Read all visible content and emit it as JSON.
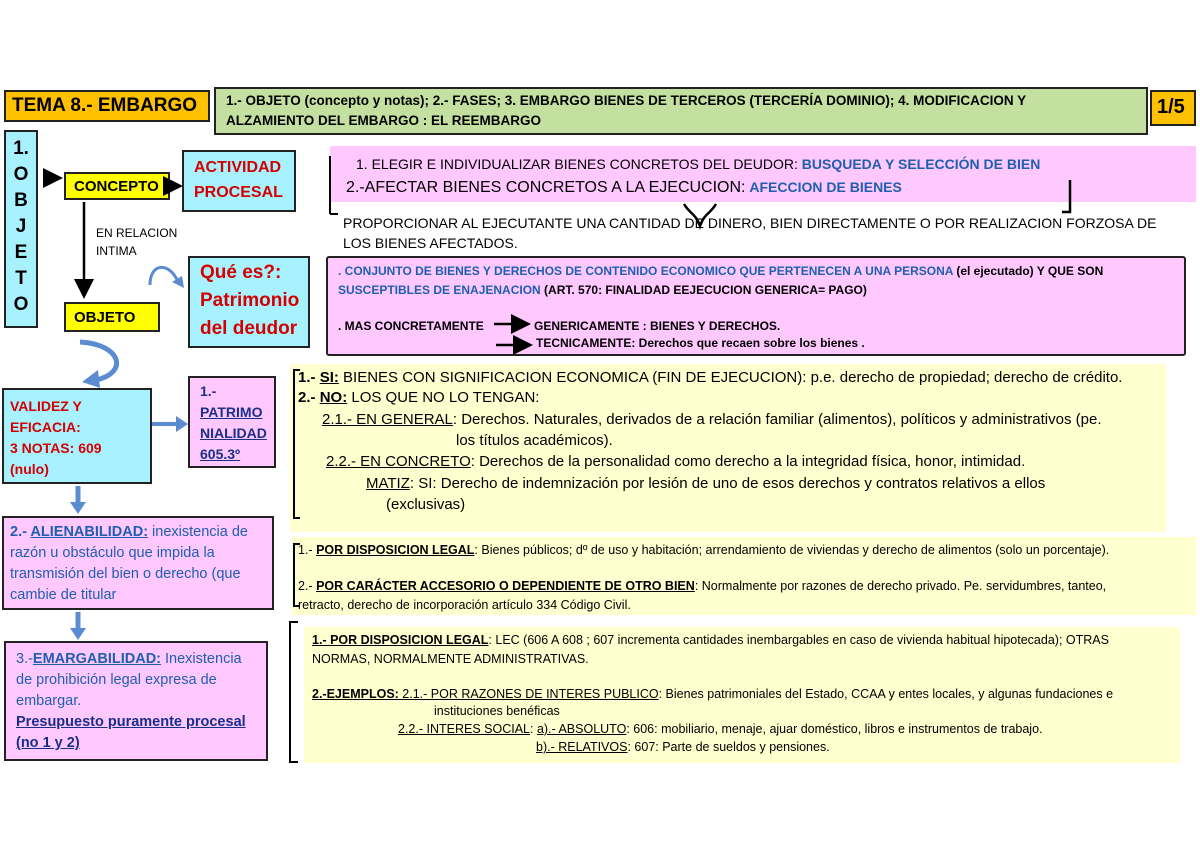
{
  "header": {
    "tema": "TEMA 8.- EMBARGO",
    "objetivos_1": "1.- OBJETO (concepto y notas); 2.- FASES; 3. EMBARGO BIENES DE TERCEROS (TERCERÍA DOMINIO); 4. MODIFICACION Y",
    "objetivos_2": "ALZAMIENTO DEL EMBARGO : EL REEMBARGO",
    "page": "1/5"
  },
  "objeto_col": [
    "1.",
    "O",
    "B",
    "J",
    "E",
    "T",
    "O"
  ],
  "concepto": "CONCEPTO",
  "actividad_1": "ACTIVIDAD",
  "actividad_2": "PROCESAL",
  "relacion_1": "EN RELACION",
  "relacion_2": "INTIMA",
  "que_es_1": "Qué es?:",
  "que_es_2": "Patrimonio",
  "que_es_3": "del deudor",
  "objeto": "OBJETO",
  "fases": {
    "f1_a": "1. ELEGIR E INDIVIDUALIZAR BIENES CONCRETOS DEL DEUDOR:",
    "f1_b": "BUSQUEDA Y SELECCIÓN DE BIEN",
    "f2_a": "2.-AFECTAR BIENES CONCRETOS A LA EJECUCION:",
    "f2_b": "AFECCION DE BIENES"
  },
  "proporcionar_1": "PROPORCIONAR AL EJECUTANTE UNA CANTIDAD DE DINERO, BIEN DIRECTAMENTE O POR REALIZACION FORZOSA DE",
  "proporcionar_2": "LOS BIENES AFECTADOS.",
  "conjunto": {
    "l1_a": ". CONJUNTO DE BIENES Y DERECHOS DE CONTENIDO ECONOMICO QUE PERTENECEN A UNA PERSONA",
    "l1_b": "(el ejecutado) Y QUE SON",
    "l2_a": "SUSCEPTIBLES DE ENAJENACION",
    "l2_b": "(ART. 570: FINALIDAD EEJECUCION GENERICA= PAGO)",
    "l3_a": ". MAS CONCRETAMENTE",
    "l3_b": "GENERICAMENTE : BIENES Y DERECHOS.",
    "l4": "TECNICAMENTE: Derechos que recaen sobre los bienes ."
  },
  "validez": [
    "VALIDEZ Y",
    "EFICACIA:",
    "3 NOTAS: 609",
    "(nulo)"
  ],
  "patrimonialidad": [
    "1.-",
    "PATRIMO",
    "NIALIDAD",
    "605.3º"
  ],
  "si_no": {
    "l1_a": "1.- ",
    "l1_b": "SI:",
    "l1_c": " BIENES CON SIGNIFICACION ECONOMICA (FIN DE EJECUCION): p.e. derecho de propiedad; derecho de crédito.",
    "l2_a": "2.- ",
    "l2_b": "NO:",
    "l2_c": " LOS QUE NO LO TENGAN:",
    "l3_a": "2.1.- EN GENERAL",
    "l3_b": ": Derechos. Naturales, derivados de a relación familiar (alimentos), políticos y administrativos (pe.",
    "l4": "los títulos académicos).",
    "l5_a": "2.2.- EN CONCRETO",
    "l5_b": ": Derechos  de la personalidad como derecho a la integridad física, honor, intimidad.",
    "l6_a": "MATIZ",
    "l6_b": ": SI: Derecho de indemnización por lesión de uno de esos derechos  y contratos relativos a ellos",
    "l7": "(exclusivas)"
  },
  "alienabilidad": {
    "a": "2.- ",
    "b": "ALIENABILIDAD:",
    "c": " inexistencia de",
    "l2": "razón u obstáculo que impida la",
    "l3": "transmisión del bien o derecho (que",
    "l4": "cambie de titular"
  },
  "disposicion": {
    "l1_a": "1.- ",
    "l1_b": "POR DISPOSICION LEGAL",
    "l1_c": ": Bienes públicos; dº de uso y habitación; arrendamiento de viviendas y derecho de alimentos (solo un porcentaje).",
    "l2_a": "2.- ",
    "l2_b": "POR CARÁCTER ACCESORIO O DEPENDIENTE DE OTRO BIEN",
    "l2_c": ": Normalmente por razones de derecho privado. Pe. servidumbres, tanteo,",
    "l3": "retracto, derecho de incorporación artículo 334 Código Civil."
  },
  "embargabilidad": {
    "a": "3.-",
    "b": "EMARGABILIDAD:",
    "c": " Inexistencia",
    "l2": "de prohibición legal expresa de",
    "l3": "embargar.",
    "l4": "Presupuesto puramente procesal",
    "l5": "(no 1 y 2)"
  },
  "legal": {
    "l1_a": "1.- ",
    "l1_b": "POR DISPOSICION LEGAL",
    "l1_c": ": LEC (606 A 608 ; 607 incrementa cantidades inembargables en caso de vivienda habitual hipotecada); OTRAS",
    "l2": "NORMAS, NORMALMENTE ADMINISTRATIVAS.",
    "l3_a": "2.-EJEMPLOS:",
    "l3_b": " 2.1.- POR RAZONES DE INTERES PUBLICO",
    "l3_c": ": Bienes patrimoniales del Estado, CCAA y entes locales, y algunas fundaciones e",
    "l4": "instituciones benéficas",
    "l5_a": "2.2.- INTERES SOCIAL",
    "l5_b": ": ",
    "l5_c": "a).- ABSOLUTO",
    "l5_d": ": 606: mobiliario, menaje, ajuar doméstico, libros e instrumentos de trabajo.",
    "l6_a": "b).- RELATIVOS",
    "l6_b": ": 607: Parte de sueldos y pensiones."
  },
  "colors": {
    "orange": "#ffc000",
    "green": "#c4e0a0",
    "cyan": "#a8f2ff",
    "pink": "#ffc8ff",
    "yellow": "#ffffd0",
    "conceptYellow": "#ffff00",
    "blue": "#1f5fb0",
    "red": "#d40000"
  }
}
